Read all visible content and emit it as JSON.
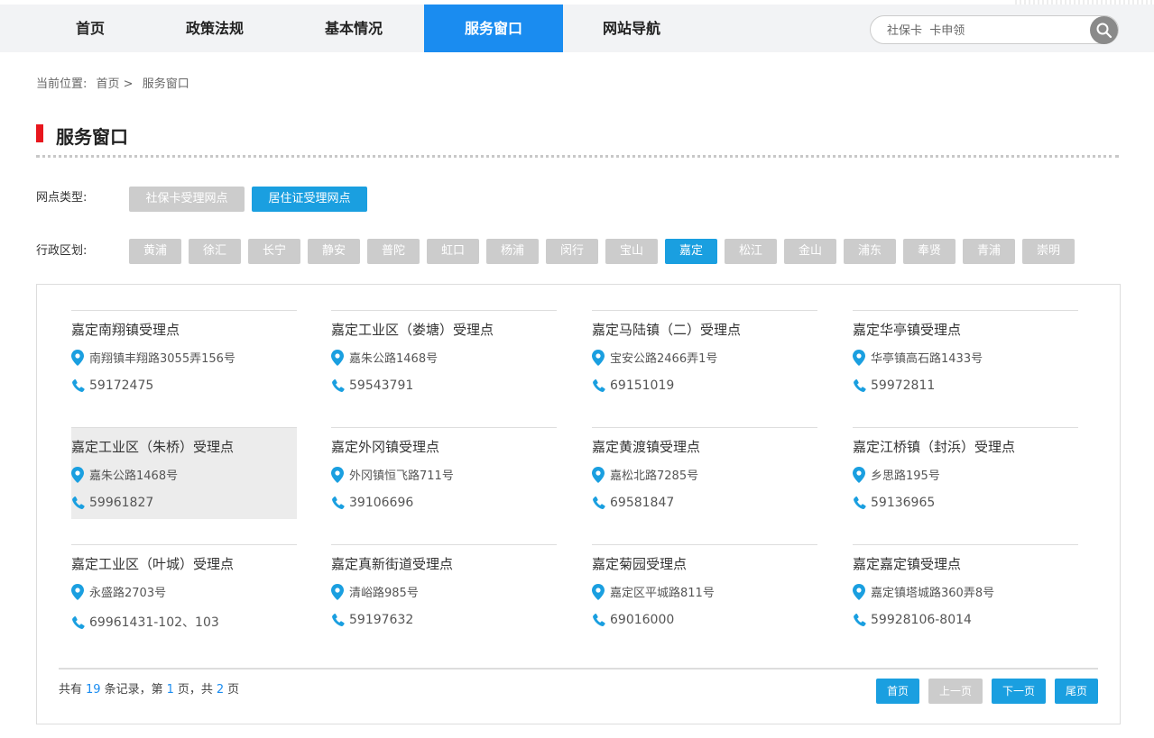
{
  "nav": {
    "items": [
      "首页",
      "政策法规",
      "基本情况",
      "服务窗口",
      "网站导航"
    ],
    "active_index": 3,
    "search_placeholder": "社保卡  卡申领"
  },
  "breadcrumb": {
    "prefix": "当前位置:",
    "home": "首页 >",
    "current": "服务窗口"
  },
  "page_title": "服务窗口",
  "filters": {
    "type_label": "网点类型:",
    "types": [
      "社保卡受理网点",
      "居住证受理网点"
    ],
    "type_active": 1,
    "district_label": "行政区划:",
    "districts": [
      "黄浦",
      "徐汇",
      "长宁",
      "静安",
      "普陀",
      "虹口",
      "杨浦",
      "闵行",
      "宝山",
      "嘉定",
      "松江",
      "金山",
      "浦东",
      "奉贤",
      "青浦",
      "崇明"
    ],
    "district_active": 9
  },
  "points": [
    {
      "name": "嘉定南翔镇受理点",
      "address": "南翔镇丰翔路3055弄156号",
      "phone": "59172475"
    },
    {
      "name": "嘉定工业区（娄塘）受理点",
      "address": "嘉朱公路1468号",
      "phone": "59543791"
    },
    {
      "name": "嘉定马陆镇（二）受理点",
      "address": "宝安公路2466弄1号",
      "phone": "69151019"
    },
    {
      "name": "嘉定华亭镇受理点",
      "address": "华亭镇高石路1433号",
      "phone": "59972811"
    },
    {
      "name": "嘉定工业区（朱桥）受理点",
      "address": "嘉朱公路1468号",
      "phone": "59961827"
    },
    {
      "name": "嘉定外冈镇受理点",
      "address": "外冈镇恒飞路711号",
      "phone": "39106696"
    },
    {
      "name": "嘉定黄渡镇受理点",
      "address": "嘉松北路7285号",
      "phone": "69581847"
    },
    {
      "name": "嘉定江桥镇（封浜）受理点",
      "address": "乡思路195号",
      "phone": "59136965"
    },
    {
      "name": "嘉定工业区（叶城）受理点",
      "address": "永盛路2703号",
      "phone": "69961431-102、103"
    },
    {
      "name": "嘉定真新街道受理点",
      "address": "清峪路985号",
      "phone": "59197632"
    },
    {
      "name": "嘉定菊园受理点",
      "address": "嘉定区平城路811号",
      "phone": "69016000"
    },
    {
      "name": "嘉定嘉定镇受理点",
      "address": "嘉定镇塔城路360弄8号",
      "phone": "59928106-8014"
    }
  ],
  "pager": {
    "text_total_prefix": "共有",
    "total": "19",
    "text_records": "条记录，第",
    "page": "1",
    "text_page_mid": "页，共",
    "pages": "2",
    "text_page_end": "页",
    "first": "首页",
    "prev": "上一页",
    "next": "下一页",
    "last": "尾页"
  },
  "colors": {
    "accent": "#1a8cf0",
    "tag_active": "#1a9fe0",
    "tag_inactive": "#cccccc",
    "title_bar": "#e8161d"
  }
}
